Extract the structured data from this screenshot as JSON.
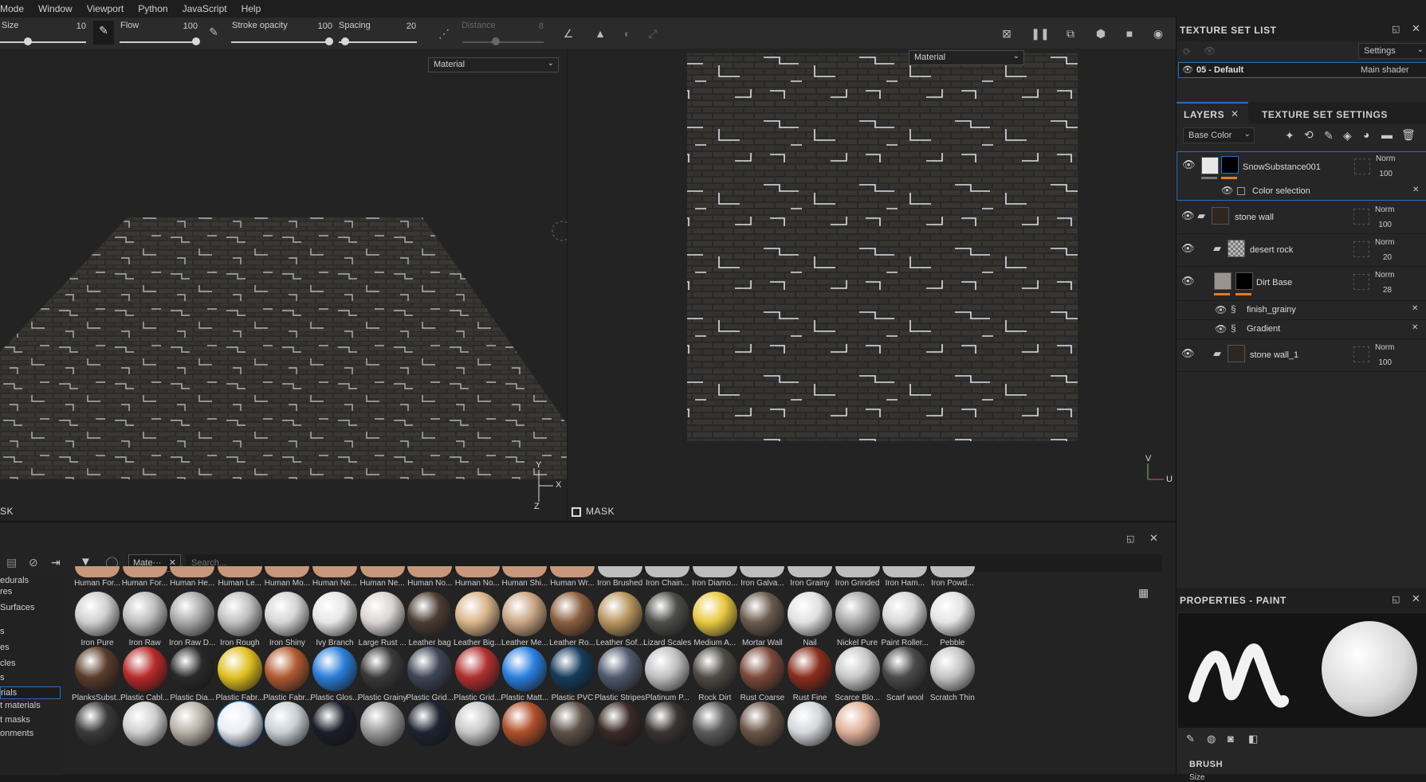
{
  "menu": [
    "Mode",
    "Window",
    "Viewport",
    "Python",
    "JavaScript",
    "Help"
  ],
  "toolbar": {
    "size_label": "Size",
    "size_value": "10",
    "flow_label": "Flow",
    "flow_value": "100",
    "stroke_opacity_label": "Stroke opacity",
    "stroke_opacity_value": "100",
    "spacing_label": "Spacing",
    "spacing_value": "20",
    "distance_label": "Distance",
    "distance_value": "8"
  },
  "viewport3d": {
    "material_select": "Material",
    "mask_label": "SK",
    "axis_y": "Y",
    "axis_x": "X",
    "axis_z": "Z"
  },
  "viewport2d": {
    "material_select": "Material",
    "mask_label": "MASK",
    "axis_v": "V",
    "axis_u": "U"
  },
  "texture_set_list": {
    "title": "TEXTURE SET LIST",
    "settings_label": "Settings",
    "item_name": "05 - Default",
    "item_shader": "Main shader"
  },
  "layers_panel": {
    "tab_layers": "LAYERS",
    "tab_texture_set_settings": "TEXTURE SET SETTINGS",
    "channel_select": "Base Color",
    "layers": [
      {
        "name": "SnowSubstance001",
        "blend": "Norm",
        "opacity": "100"
      },
      {
        "name": "Color selection"
      },
      {
        "name": "stone wall",
        "blend": "Norm",
        "opacity": "100"
      },
      {
        "name": "desert rock",
        "blend": "Norm",
        "opacity": "20"
      },
      {
        "name": "Dirt Base",
        "blend": "Norm",
        "opacity": "28"
      },
      {
        "name": "finish_grainy"
      },
      {
        "name": "Gradient"
      },
      {
        "name": "stone wall_1",
        "blend": "Norm",
        "opacity": "100"
      }
    ]
  },
  "properties": {
    "title": "PROPERTIES - PAINT",
    "brush_label": "BRUSH",
    "size_label": "Size"
  },
  "shelf": {
    "filter_tag": "Mate···",
    "search_placeholder": "Search...",
    "side_items": [
      "edurals",
      "res",
      "Surfaces",
      "s",
      "es",
      "cles",
      "s",
      "rials",
      "t materials",
      "t masks",
      "onments"
    ],
    "top_labels": [
      "Human For...",
      "Human For...",
      "Human He...",
      "Human Le...",
      "Human Mo...",
      "Human Ne...",
      "Human Ne...",
      "Human No...",
      "Human No...",
      "Human Shi...",
      "Human Wr...",
      "Iron Brushed",
      "Iron Chain...",
      "Iron Diamo...",
      "Iron Galva...",
      "Iron Grainy",
      "Iron Grinded",
      "Iron Ham...",
      "Iron Powd..."
    ],
    "row1": [
      "Iron Pure",
      "Iron Raw",
      "Iron Raw D...",
      "Iron Rough",
      "Iron Shiny",
      "Ivy Branch",
      "Large Rust ...",
      "Leather bag",
      "Leather Big...",
      "Leather Me...",
      "Leather Ro...",
      "Leather Sof...",
      "Lizard Scales",
      "Medium A...",
      "Mortar Wall",
      "Nail",
      "Nickel Pure",
      "Paint Roller...",
      "Pebble"
    ],
    "row2": [
      "PlanksSubst...",
      "Plastic Cabl...",
      "Plastic Dia...",
      "Plastic Fabr...",
      "Plastic Fabr...",
      "Plastic Glos...",
      "Plastic Grainy",
      "Plastic Grid...",
      "Plastic Grid...",
      "Plastic Matt...",
      "Plastic PVC",
      "Plastic Stripes",
      "Platinum P...",
      "Rock Dirt",
      "Rust Coarse",
      "Rust Fine",
      "Scarce Blo...",
      "Scarf wool",
      "Scratch Thin"
    ]
  },
  "colors": {
    "accent_blue": "#2a6fbf",
    "orange": "#e87b1e"
  }
}
